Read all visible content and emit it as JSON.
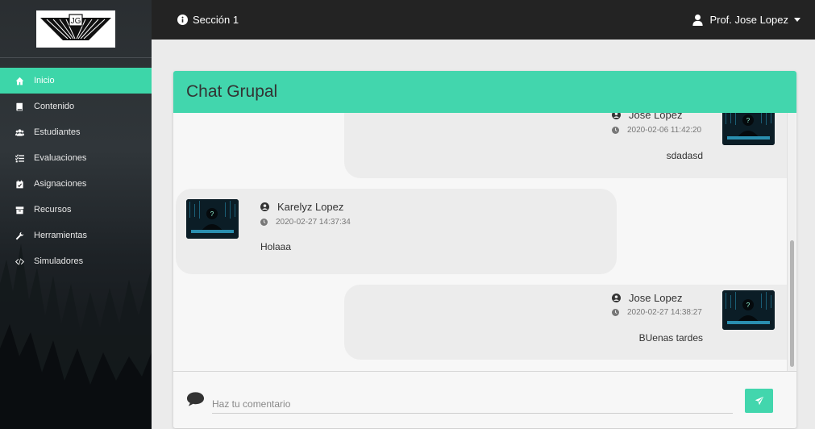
{
  "topbar": {
    "section_label": "Sección 1",
    "user_name": "Prof. Jose Lopez"
  },
  "sidebar": {
    "items": [
      {
        "label": "Inicio",
        "icon": "home-icon",
        "active": true
      },
      {
        "label": "Contenido",
        "icon": "book-icon"
      },
      {
        "label": "Estudiantes",
        "icon": "users-icon"
      },
      {
        "label": "Evaluaciones",
        "icon": "tasks-icon"
      },
      {
        "label": "Asignaciones",
        "icon": "calendar-check-icon"
      },
      {
        "label": "Recursos",
        "icon": "archive-icon"
      },
      {
        "label": "Herramientas",
        "icon": "wrench-icon"
      },
      {
        "label": "Simuladores",
        "icon": "code-icon"
      }
    ]
  },
  "chat": {
    "title": "Chat Grupal",
    "messages": [
      {
        "author": "Jose Lopez",
        "timestamp": "2020-02-06 11:42:20",
        "text": "sdadasd",
        "side": "right"
      },
      {
        "author": "Karelyz Lopez",
        "timestamp": "2020-02-27 14:37:34",
        "text": "Holaaa",
        "side": "left"
      },
      {
        "author": "Jose Lopez",
        "timestamp": "2020-02-27 14:38:27",
        "text": "BUenas tardes",
        "side": "right"
      }
    ],
    "composer": {
      "placeholder": "Haz tu comentario"
    }
  },
  "colors": {
    "accent": "#42d6ad",
    "topbar": "#232323",
    "bubble": "#ececec"
  }
}
